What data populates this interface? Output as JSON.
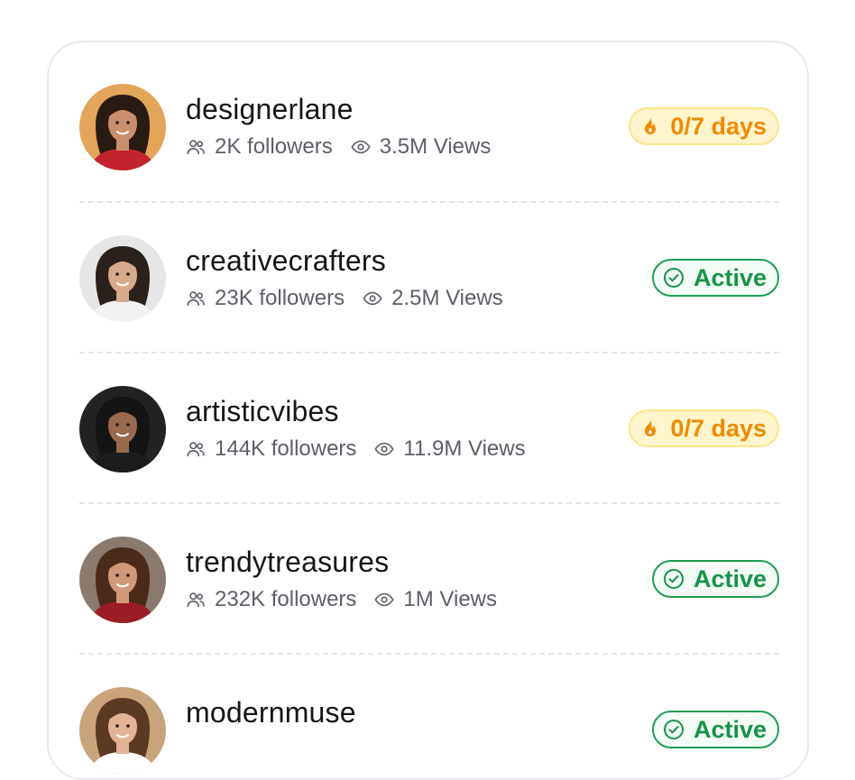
{
  "users": [
    {
      "username": "designerlane",
      "followers": "2K followers",
      "views": "3.5M Views",
      "status": "0/7 days",
      "status_type": "streak",
      "avatar_colors": {
        "bg": "#e3a55a",
        "skin": "#c98f6a",
        "hair": "#2a1a14",
        "shirt": "#c3232c"
      }
    },
    {
      "username": "creativecrafters",
      "followers": "23K followers",
      "views": "2.5M Views",
      "status": "Active",
      "status_type": "active",
      "avatar_colors": {
        "bg": "#e6e6e6",
        "skin": "#d9a98c",
        "hair": "#2b211c",
        "shirt": "#f2f2f2"
      }
    },
    {
      "username": "artisticvibes",
      "followers": "144K followers",
      "views": "11.9M Views",
      "status": "0/7 days",
      "status_type": "streak",
      "avatar_colors": {
        "bg": "#222222",
        "skin": "#9a6a4e",
        "hair": "#141414",
        "shirt": "#1c1c1c"
      }
    },
    {
      "username": "trendytreasures",
      "followers": "232K followers",
      "views": "1M Views",
      "status": "Active",
      "status_type": "active",
      "avatar_colors": {
        "bg": "#8a7a6e",
        "skin": "#d1997a",
        "hair": "#4a2a1a",
        "shirt": "#9c1c26"
      }
    },
    {
      "username": "modernmuse",
      "followers": "",
      "views": "",
      "status": "Active",
      "status_type": "active",
      "avatar_colors": {
        "bg": "#c9a47a",
        "skin": "#e2b396",
        "hair": "#5a3a22",
        "shirt": "#ffffff"
      }
    }
  ],
  "colors": {
    "streak_text": "#f08a00",
    "streak_bg": "#fff5cc",
    "active_text": "#169447",
    "active_border": "#1f9d55",
    "divider": "#e4e5ea"
  },
  "icons": {
    "followers": "users-icon",
    "views": "eye-icon",
    "streak": "fire-icon",
    "active": "check-circle-icon"
  }
}
